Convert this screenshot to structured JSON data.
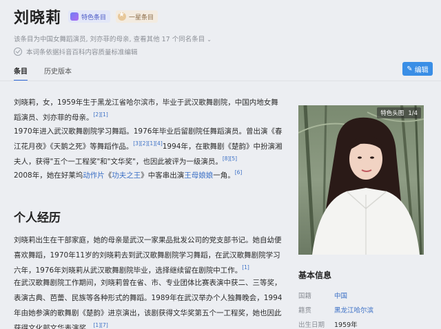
{
  "header": {
    "title": "刘晓莉",
    "featured_badge": "特色条目",
    "star_badge": "一星条目",
    "description": "该条目为中国女舞蹈演员, 刘亦菲的母亲, 查看其他 17 个同名条目",
    "description_chevron": "⌄",
    "certification": "本词条依据抖音百科内容质量标准编辑",
    "edit_label": "编辑",
    "edit_icon": "pencil-icon"
  },
  "tabs": [
    {
      "label": "条目",
      "active": true
    },
    {
      "label": "历史版本",
      "active": false
    }
  ],
  "intro": {
    "p1_text": "刘晓莉，女，1959年生于黑龙江省哈尔滨市，毕业于武汉歌舞剧院，中国内地女舞蹈演员、刘亦菲的母亲。",
    "p1_refs": "[2][1]",
    "p2_a": "1970年进入武汉歌舞剧院学习舞蹈。1976年毕业后留剧院任舞蹈演员。曾出演《春江花月夜》《天鹅之死》等舞蹈作品。",
    "p2_refs1": "[3][2][1][4]",
    "p2_b": "1994年，在歌舞剧《楚韵》中扮演湘夫人，获得\"五个一工程奖\"和\"文华奖\"，也因此被评为一级演员。",
    "p2_refs2": "[8][5]",
    "p3_a": "2008年，她在好莱坞",
    "p3_link1": "动作片",
    "p3_b": "《",
    "p3_link2": "功夫之王",
    "p3_c": "》中客串出演",
    "p3_link3": "王母娘娘",
    "p3_d": "一角。",
    "p3_refs": "[6]"
  },
  "section": {
    "title": "个人经历",
    "p4_text": "刘晓莉出生在干部家庭，她的母亲是武汉一家果品批发公司的党支部书记。她自幼便喜欢舞蹈，1970年11岁的刘晓莉去到武汉歌舞剧院学习舞蹈，在武汉歌舞剧院学习六年，1976年刘晓莉从武汉歌舞剧院毕业，选择继续留在剧院中工作。",
    "p4_refs": "[1]",
    "p5_text": "在武汉歌舞剧院工作期间，刘晓莉曾在省、市、专业团体比赛表演中获二、三等奖，表演古典、芭蕾、民族等各种形式的舞蹈。1989年在武汉举办个人独舞晚会，1994年由她参演的歌舞剧《楚韵》进京演出，该剧获得文华奖第五个一工程奖，她也因此获得文化部文华表演奖。",
    "p5_refs": "[1][7]"
  },
  "photo": {
    "label": "特色头图",
    "count": "1/4"
  },
  "info": {
    "title": "基本信息",
    "rows": [
      {
        "key": "国籍",
        "value": "中国"
      },
      {
        "key": "籍贯",
        "value": "黑龙江哈尔滨"
      },
      {
        "key": "出生日期",
        "value": "1959年"
      }
    ]
  },
  "colors": {
    "accent": "#3a8ee6",
    "link": "#3a6fc5",
    "background": "#eceef2"
  }
}
